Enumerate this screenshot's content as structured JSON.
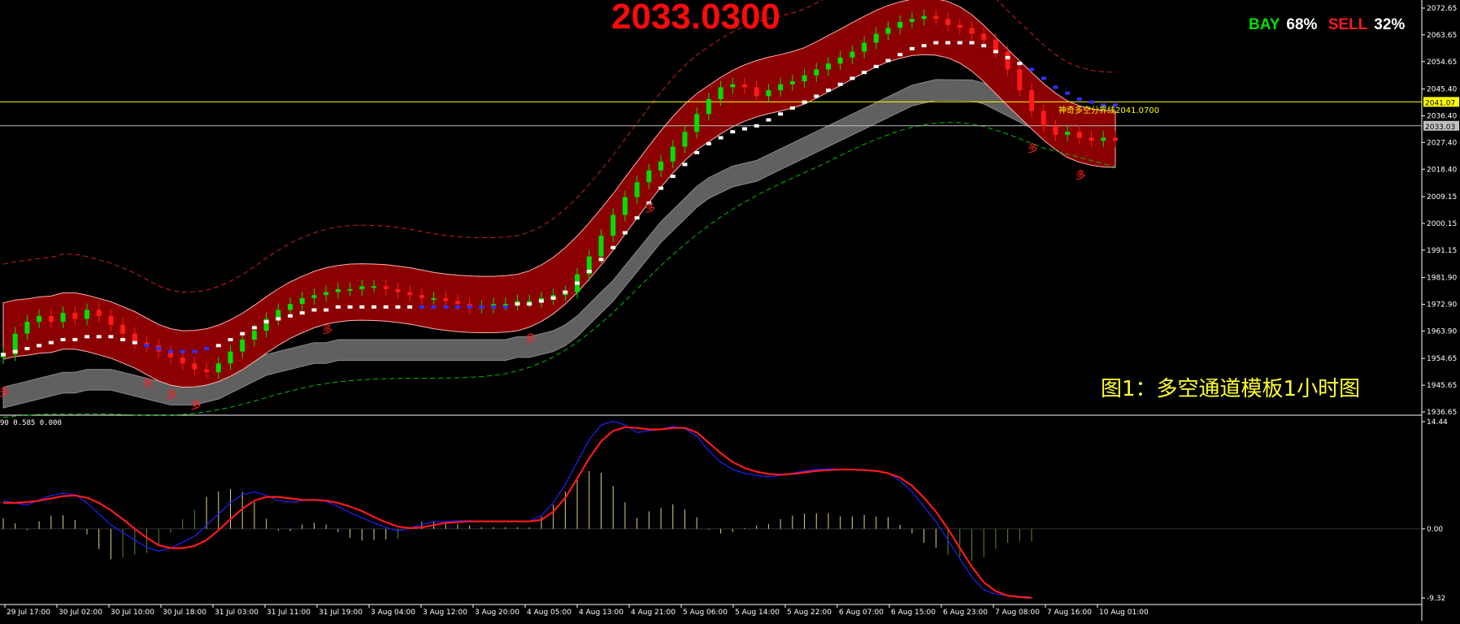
{
  "header": {
    "current_price": "2033.0300",
    "bay_label": "BAY",
    "bay_pct": "68%",
    "sell_label": "SELL",
    "sell_pct": "32%"
  },
  "annotation": {
    "caption": "图1：多空通道模板1小时图",
    "boundary_label": "神奇多空分界线2041.0700",
    "signal_char": "多",
    "oscillator_params": "90 0.585 0.000"
  },
  "chart_data": {
    "type": "candlestick",
    "x_tick_labels": [
      "29 Jul 17:00",
      "30 Jul 02:00",
      "30 Jul 10:00",
      "30 Jul 18:00",
      "31 Jul 03:00",
      "31 Jul 11:00",
      "31 Jul 19:00",
      "3 Aug 04:00",
      "3 Aug 12:00",
      "3 Aug 20:00",
      "4 Aug 05:00",
      "4 Aug 13:00",
      "4 Aug 21:00",
      "5 Aug 06:00",
      "5 Aug 14:00",
      "5 Aug 22:00",
      "6 Aug 07:00",
      "6 Aug 15:00",
      "6 Aug 23:00",
      "7 Aug 08:00",
      "7 Aug 16:00",
      "10 Aug 01:00"
    ],
    "price_axis_ticks": [
      "2072.65",
      "2063.65",
      "2054.65",
      "2045.40",
      "2036.40",
      "2027.40",
      "2018.40",
      "2009.15",
      "2000.15",
      "1991.15",
      "1981.90",
      "1972.90",
      "1963.90",
      "1954.65",
      "1945.65",
      "1936.65"
    ],
    "price_ylim": [
      1936.65,
      2072.65
    ],
    "price_levels": [
      {
        "label": "2041.07",
        "value": 2041.07,
        "color": "#ffff00"
      },
      {
        "label": "2033.03",
        "value": 2033.03,
        "color": "#c0c0c0"
      }
    ],
    "osc_axis_ticks": [
      "14.44",
      "0.00",
      "-9.32"
    ],
    "osc_ylim": [
      -9.32,
      14.44
    ],
    "close": [
      1956,
      1963,
      1967,
      1969,
      1967,
      1970,
      1968,
      1971,
      1969,
      1966,
      1963,
      1960,
      1959,
      1957,
      1955,
      1953,
      1951,
      1950,
      1953,
      1957,
      1961,
      1964,
      1968,
      1971,
      1973,
      1975,
      1976,
      1977,
      1978,
      1978,
      1979,
      1979,
      1978,
      1977,
      1976,
      1975,
      1975,
      1974,
      1973,
      1972,
      1972,
      1973,
      1973,
      1974,
      1974,
      1975,
      1976,
      1977,
      1983,
      1989,
      1996,
      2003,
      2009,
      2014,
      2018,
      2021,
      2026,
      2031,
      2037,
      2042,
      2046,
      2047,
      2046,
      2043,
      2045,
      2047,
      2048,
      2050,
      2052,
      2054,
      2056,
      2058,
      2061,
      2064,
      2066,
      2068,
      2069,
      2070,
      2069,
      2067,
      2066,
      2064,
      2062,
      2058,
      2052,
      2045,
      2038,
      2033,
      2030,
      2031,
      2029,
      2028,
      2029,
      2028
    ],
    "trend_line": [
      1956,
      1957,
      1958,
      1959,
      1960,
      1961,
      1961,
      1962,
      1962,
      1962,
      1961,
      1960,
      1959,
      1958,
      1957,
      1957,
      1957,
      1958,
      1959,
      1961,
      1963,
      1965,
      1967,
      1968,
      1969,
      1970,
      1971,
      1971,
      1972,
      1972,
      1972,
      1972,
      1972,
      1972,
      1972,
      1972,
      1972,
      1972,
      1972,
      1972,
      1972,
      1972,
      1972,
      1973,
      1973,
      1974,
      1975,
      1977,
      1980,
      1984,
      1988,
      1992,
      1997,
      2002,
      2007,
      2012,
      2016,
      2020,
      2024,
      2027,
      2029,
      2031,
      2032,
      2033,
      2035,
      2037,
      2039,
      2041,
      2043,
      2045,
      2047,
      2049,
      2051,
      2053,
      2055,
      2057,
      2059,
      2060,
      2061,
      2061,
      2061,
      2061,
      2060,
      2058,
      2056,
      2054,
      2052,
      2049,
      2046,
      2044,
      2042,
      2041,
      2040,
      2040
    ],
    "macd": [
      3.8,
      3.5,
      3.2,
      3.9,
      4.5,
      4.8,
      4.6,
      3.5,
      2.0,
      0.5,
      -0.5,
      -1.5,
      -2.5,
      -3.0,
      -2.6,
      -1.8,
      -1.0,
      0.5,
      2.0,
      3.5,
      4.6,
      5.0,
      4.5,
      3.8,
      3.6,
      3.8,
      3.9,
      3.7,
      3.0,
      2.2,
      1.5,
      0.8,
      0.2,
      -0.3,
      0.1,
      0.6,
      0.9,
      1.0,
      1.1,
      1.1,
      1.0,
      1.0,
      1.0,
      1.0,
      1.0,
      1.8,
      3.5,
      6.0,
      9.0,
      12.0,
      14.0,
      14.5,
      14.0,
      13.0,
      13.2,
      13.4,
      13.8,
      13.5,
      12.5,
      10.5,
      9.0,
      8.0,
      7.5,
      7.2,
      7.0,
      7.2,
      7.5,
      7.8,
      8.0,
      8.1,
      8.0,
      8.0,
      8.0,
      7.8,
      7.5,
      6.5,
      5.0,
      3.0,
      1.0,
      -1.5,
      -4.0,
      -6.5,
      -8.2,
      -8.8,
      -9.0,
      -9.1,
      -9.2
    ],
    "signal": [
      3.5,
      3.5,
      3.6,
      3.8,
      4.1,
      4.4,
      4.5,
      4.2,
      3.5,
      2.5,
      1.3,
      0.0,
      -1.2,
      -2.2,
      -2.6,
      -2.6,
      -2.3,
      -1.5,
      -0.2,
      1.3,
      2.7,
      3.8,
      4.3,
      4.3,
      4.1,
      3.9,
      3.9,
      3.8,
      3.5,
      3.0,
      2.4,
      1.6,
      0.9,
      0.3,
      0.1,
      0.2,
      0.5,
      0.8,
      0.9,
      1.0,
      1.0,
      1.0,
      1.0,
      1.0,
      1.0,
      1.2,
      2.3,
      4.2,
      6.8,
      9.5,
      11.8,
      13.2,
      13.7,
      13.6,
      13.4,
      13.4,
      13.6,
      13.6,
      13.0,
      11.6,
      10.2,
      9.0,
      8.2,
      7.7,
      7.4,
      7.3,
      7.4,
      7.6,
      7.8,
      7.9,
      8.0,
      8.0,
      7.9,
      7.8,
      7.5,
      6.9,
      5.8,
      4.2,
      2.3,
      0.0,
      -2.6,
      -5.1,
      -7.2,
      -8.4,
      -9.0,
      -9.2,
      -9.3
    ],
    "signal_markers": [
      {
        "label": "多",
        "x_index": 0
      },
      {
        "label": "多",
        "x_index": 12
      },
      {
        "label": "多",
        "x_index": 14
      },
      {
        "label": "多",
        "x_index": 16
      },
      {
        "label": "多",
        "x_index": 27
      },
      {
        "label": "多",
        "x_index": 44
      },
      {
        "label": "多",
        "x_index": 54
      },
      {
        "label": "多",
        "x_index": 86
      },
      {
        "label": "多",
        "x_index": 90
      }
    ],
    "colors": {
      "channel_fill": "#8b0000",
      "channel_edge": "#ffb0b0",
      "gray_band": "#606060",
      "bull_candle": "#00e000",
      "bear_candle": "#ff1a1a",
      "outer_dash": "#d02020",
      "green_dash": "#00c000",
      "white_steps": "#ffffff",
      "blue_steps": "#3030ff",
      "macd_line": "#2020ff",
      "signal_line": "#ff1a1a"
    }
  }
}
